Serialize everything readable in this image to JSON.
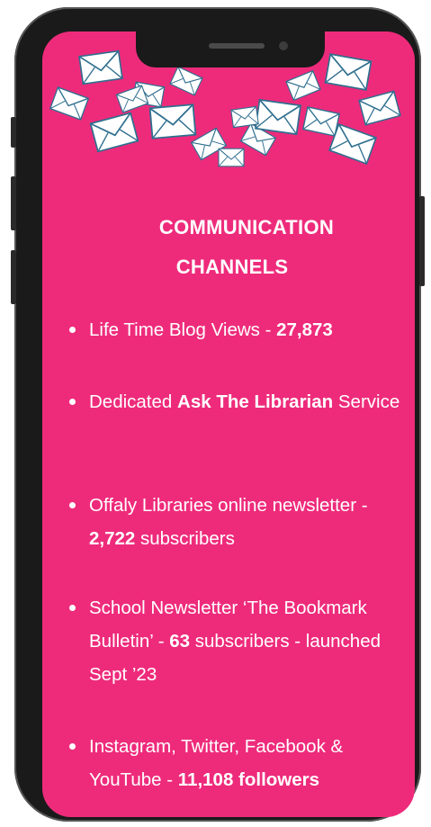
{
  "title_line1": "COMMUNICATION",
  "title_line2": "CHANNELS",
  "items": [
    {
      "pre": "Life Time Blog Views - ",
      "bold": "27,873",
      "post": "",
      "pre2": "",
      "bold2": "",
      "post2": ""
    },
    {
      "pre": "Dedicated ",
      "bold": "Ask The Librarian",
      "post": " Service"
    },
    {
      "pre": "Offaly Libraries online newsletter - ",
      "bold": "2,722",
      "post": " subscribers"
    },
    {
      "pre": "School Newsletter ‘The Bookmark  Bulletin’ - ",
      "bold": "63",
      "post": " subscribers  - launched Sept ’23"
    },
    {
      "pre": "Instagram, Twitter, Facebook   & YouTube -  ",
      "bold": "11,108 followers",
      "post": ""
    }
  ],
  "colors": {
    "screen": "#ee2b7b",
    "phone": "#1a1a1a",
    "envelope_stroke": "#2f6f8f"
  },
  "icons": {
    "decoration": "envelope-icon"
  }
}
